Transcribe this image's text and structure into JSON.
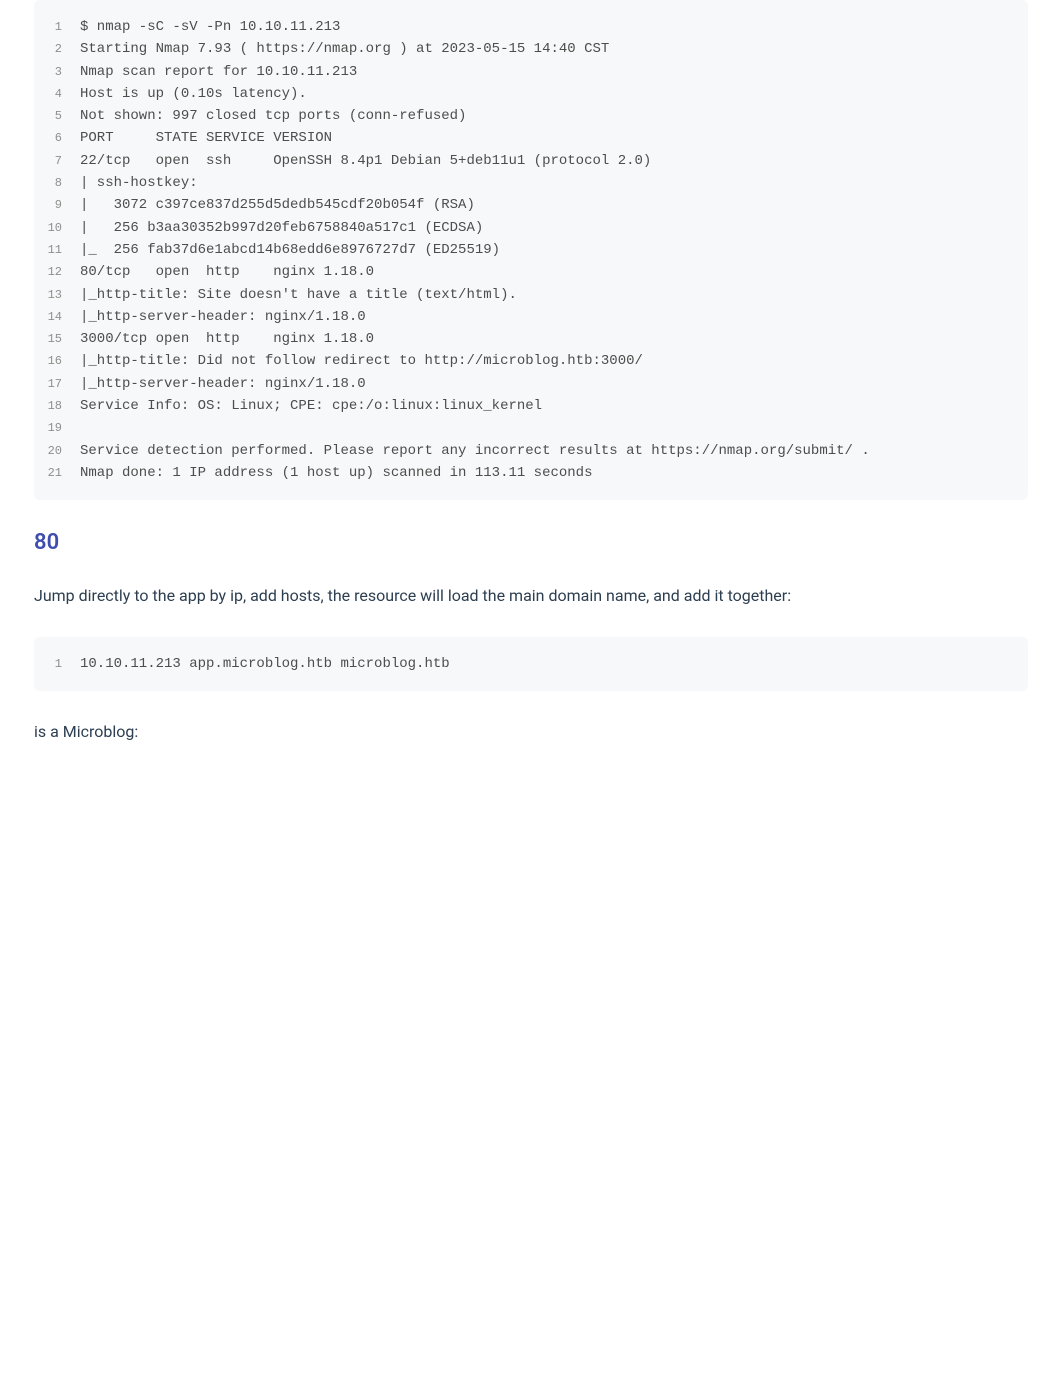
{
  "codeblock1": {
    "lines": [
      "$ nmap -sC -sV -Pn 10.10.11.213",
      "Starting Nmap 7.93 ( https://nmap.org ) at 2023-05-15 14:40 CST",
      "Nmap scan report for 10.10.11.213",
      "Host is up (0.10s latency).",
      "Not shown: 997 closed tcp ports (conn-refused)",
      "PORT     STATE SERVICE VERSION",
      "22/tcp   open  ssh     OpenSSH 8.4p1 Debian 5+deb11u1 (protocol 2.0)",
      "| ssh-hostkey:",
      "|   3072 c397ce837d255d5dedb545cdf20b054f (RSA)",
      "|   256 b3aa30352b997d20feb6758840a517c1 (ECDSA)",
      "|_  256 fab37d6e1abcd14b68edd6e8976727d7 (ED25519)",
      "80/tcp   open  http    nginx 1.18.0",
      "|_http-title: Site doesn't have a title (text/html).",
      "|_http-server-header: nginx/1.18.0",
      "3000/tcp open  http    nginx 1.18.0",
      "|_http-title: Did not follow redirect to http://microblog.htb:3000/",
      "|_http-server-header: nginx/1.18.0",
      "Service Info: OS: Linux; CPE: cpe:/o:linux:linux_kernel",
      "",
      "Service detection performed. Please report any incorrect results at https://nmap.org/submit/ .",
      "Nmap done: 1 IP address (1 host up) scanned in 113.11 seconds"
    ]
  },
  "heading1": "80",
  "paragraph1": "Jump directly to the app by ip, add hosts, the resource will load the main domain name, and add it together:",
  "codeblock2": {
    "lines": [
      "10.10.11.213 app.microblog.htb microblog.htb"
    ]
  },
  "paragraph2": "is a Microblog:"
}
